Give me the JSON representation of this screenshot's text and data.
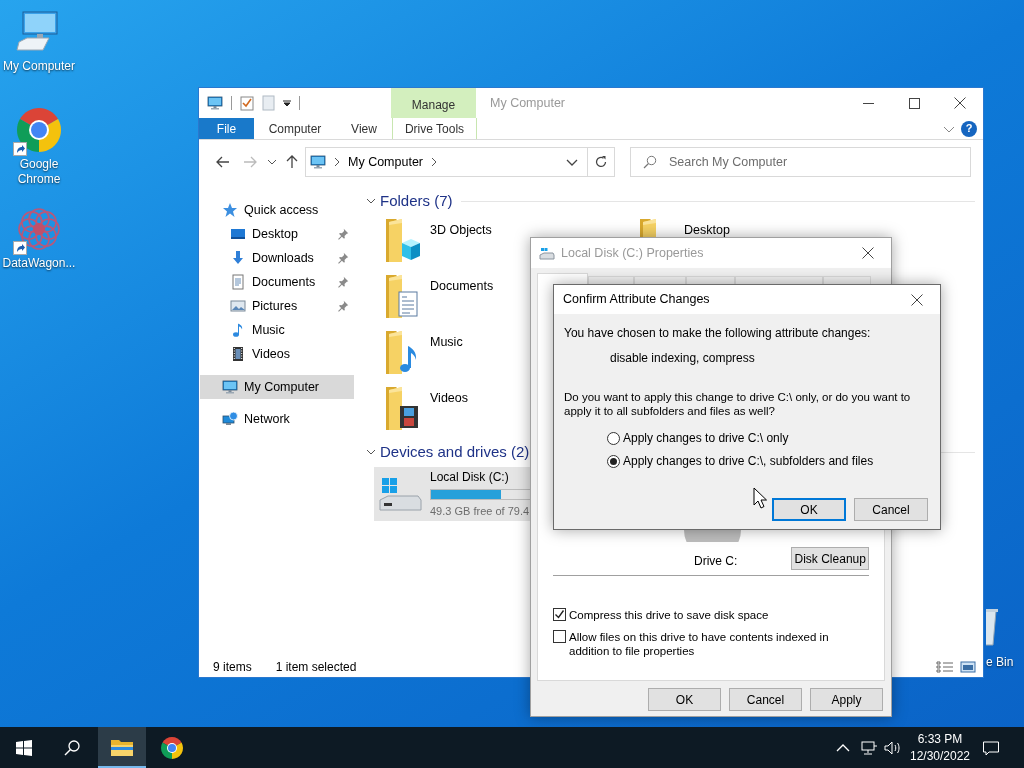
{
  "desktop_icons": [
    {
      "kind": "computer",
      "label": "My Computer",
      "shortcut": false
    },
    {
      "kind": "chrome",
      "label": "Google Chrome",
      "shortcut": true
    },
    {
      "kind": "app",
      "label": "DataWagon...",
      "shortcut": true
    },
    {
      "kind": "recycle",
      "label": "e Bin"
    }
  ],
  "explorer": {
    "title": "My Computer",
    "context_tab": "Manage",
    "ribbon_tabs": [
      {
        "label": "File",
        "selected": true
      },
      {
        "label": "Computer",
        "selected": false
      },
      {
        "label": "View",
        "selected": false
      },
      {
        "label": "Drive Tools",
        "selected": false
      }
    ],
    "help": "?",
    "address": "My Computer",
    "search": {
      "placeholder": "Search My Computer"
    },
    "nav": [
      {
        "kind": "star",
        "label": "Quick access",
        "selected": false,
        "children": [
          {
            "kind": "desktop",
            "label": "Desktop",
            "pinned": true,
            "selected": false
          },
          {
            "kind": "downloads",
            "label": "Downloads",
            "pinned": true,
            "selected": false
          },
          {
            "kind": "documents",
            "label": "Documents",
            "pinned": true,
            "selected": false
          },
          {
            "kind": "pictures",
            "label": "Pictures",
            "pinned": true,
            "selected": false
          },
          {
            "kind": "music",
            "label": "Music",
            "pinned": false,
            "selected": false
          },
          {
            "kind": "videos",
            "label": "Videos",
            "pinned": false,
            "selected": false
          }
        ]
      },
      {
        "kind": "computer",
        "label": "My Computer",
        "selected": true
      },
      {
        "kind": "network",
        "label": "Network",
        "selected": false
      }
    ],
    "folders": {
      "heading": "Folders (7)",
      "items": [
        {
          "kind": "cube",
          "label": "3D Objects"
        },
        {
          "kind": "documents",
          "label": "Documents"
        },
        {
          "kind": "music",
          "label": "Music"
        },
        {
          "kind": "videos",
          "label": "Videos"
        },
        {
          "kind": "plain",
          "label": "Desktop"
        }
      ]
    },
    "drives": {
      "heading": "Devices and drives (2)",
      "items": [
        {
          "label": "Local Disk (C:)",
          "level": 0.38,
          "free": "49.3 GB free of 79.4",
          "selected": true
        }
      ]
    },
    "status": [
      "9 items",
      "1 item selected"
    ]
  },
  "properties": {
    "title": "Local Disk (C:) Properties",
    "tabs": [
      {
        "selected": true
      },
      {
        "selected": false
      },
      {
        "selected": false
      },
      {
        "selected": false
      },
      {
        "selected": false
      },
      {
        "selected": false
      }
    ],
    "drive_label": "Drive C:",
    "cleanup_button": "Disk Cleanup",
    "options": [
      {
        "label": "Compress this drive to save disk space",
        "checked": true
      },
      {
        "label": "Allow files on this drive to have contents indexed in addition to file properties",
        "checked": false
      }
    ],
    "buttons": [
      "OK",
      "Cancel",
      "Apply"
    ]
  },
  "confirm": {
    "title": "Confirm Attribute Changes",
    "intro": "You have chosen to make the following attribute changes:",
    "changes": "disable indexing, compress",
    "question": "Do you want to apply this change to drive C:\\ only, or do you want to apply it to all subfolders and files as well?",
    "choices": [
      {
        "label": "Apply changes to drive C:\\ only",
        "selected": false
      },
      {
        "label": "Apply changes to drive C:\\, subfolders and files",
        "selected": true
      }
    ],
    "buttons": [
      {
        "label": "OK",
        "default": true
      },
      {
        "label": "Cancel",
        "default": false
      }
    ]
  },
  "taskbar": {
    "apps": [
      {
        "kind": "explorer",
        "active": true
      },
      {
        "kind": "chrome",
        "active": false
      }
    ],
    "time": "6:33 PM",
    "date": "12/30/2022"
  }
}
